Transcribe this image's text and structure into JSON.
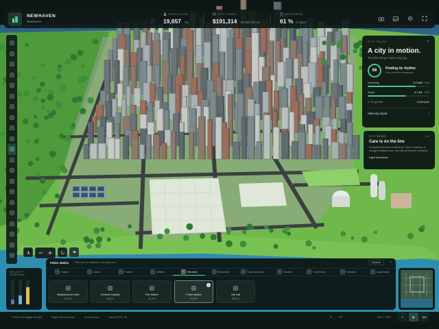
{
  "city": {
    "name": "NEWHAVEN",
    "subtitle": "Newhaven"
  },
  "stats": {
    "population": {
      "label": "POPULATION",
      "value": "19,657",
      "delta": "+12"
    },
    "funds": {
      "label": "CITY FUNDS",
      "value": "$191,314",
      "delta": "+$3,850 this mo"
    },
    "happiness": {
      "label": "HAPPINESS",
      "value": "61 %",
      "status": "Content"
    }
  },
  "top_icons": [
    "camera-icon",
    "photo-icon",
    "settings-icon",
    "fullscreen-icon"
  ],
  "left_tools": [
    "road-icon",
    "zone-icon",
    "bulldoze-icon",
    "water-icon",
    "power-icon",
    "pipe-icon",
    "park-icon",
    "transit-icon",
    "bus-icon",
    "train-icon",
    "police-icon",
    "fire-icon",
    "health-icon",
    "education-icon",
    "landmark-icon",
    "district-icon",
    "policy-icon",
    "budget-icon",
    "chart-icon",
    "info-icon",
    "alert-icon"
  ],
  "info_panel": {
    "eyebrow": "CITY PULSE",
    "title": "A city in motion.",
    "subtitle": "The little things make a big city.",
    "score": "66",
    "score_heading": "Finding its rhythm.",
    "score_body": "Keep services balanced.",
    "meters": [
      {
        "label": "Electricity",
        "value": "8.2 MW",
        "delta": "+0.4",
        "fill": 0.78
      },
      {
        "label": "Water",
        "value": "6.1 ML",
        "delta": "+0.2",
        "fill": 0.62
      }
    ],
    "kv": [
      {
        "k": "2.1% growth",
        "v": "3,160 jobs"
      }
    ],
    "link": "View city report"
  },
  "news_card": {
    "eyebrow": "CITY NEWS",
    "time": "2m",
    "title": "Care is on the line",
    "body": "A hospital will reach a milestone. Clinic emissions in storage available soon, and city services for residents.",
    "link": "Light resources"
  },
  "build_panel": {
    "name": "Police station",
    "hint": "Click the line districts, including fires.",
    "sort": "Browse",
    "tabs": [
      {
        "label": "Roads",
        "icon": "road-icon"
      },
      {
        "label": "Zones",
        "icon": "zone-icon"
      },
      {
        "label": "Transit",
        "icon": "transit-icon"
      },
      {
        "label": "Utilities",
        "icon": "power-icon"
      },
      {
        "label": "Services",
        "icon": "police-icon",
        "active": true
      },
      {
        "label": "Education",
        "icon": "education-icon"
      },
      {
        "label": "Parks & leisure",
        "icon": "park-icon"
      },
      {
        "label": "Tourism",
        "icon": "tourism-icon"
      },
      {
        "label": "Commerce",
        "icon": "commerce-icon"
      },
      {
        "label": "Industry",
        "icon": "industry-icon"
      },
      {
        "label": "Landmarks",
        "icon": "landmark-icon"
      }
    ],
    "cards": [
      {
        "name": "Neighborhood clinic",
        "price": "$3,000",
        "icon": "clinic-icon"
      },
      {
        "name": "General hospital",
        "price": "$9,500",
        "icon": "hospital-icon"
      },
      {
        "name": "Fire station",
        "price": "$4,200",
        "icon": "fire-icon"
      },
      {
        "name": "Police station",
        "price": "$3,800",
        "icon": "police-icon",
        "selected": true
      },
      {
        "name": "City hall",
        "price": "$8,000",
        "icon": "cityhall-icon"
      }
    ]
  },
  "security": {
    "title": "SECURITY COVERAGE",
    "bars": [
      {
        "fill": 0.2,
        "color": "#5a7aa8"
      },
      {
        "fill": 0.35,
        "color": "#6fb0e0"
      },
      {
        "fill": 0.7,
        "color": "#e3c04f"
      }
    ]
  },
  "status_bar": {
    "left": [
      "Press G to toggle the grid",
      "Right-click to cancel",
      "Un-zone tool",
      "Save (CTRL+S)"
    ],
    "temp": "24°",
    "date": "Feb 4, 2027",
    "speeds": [
      "II",
      "▶",
      "▶▶"
    ]
  }
}
